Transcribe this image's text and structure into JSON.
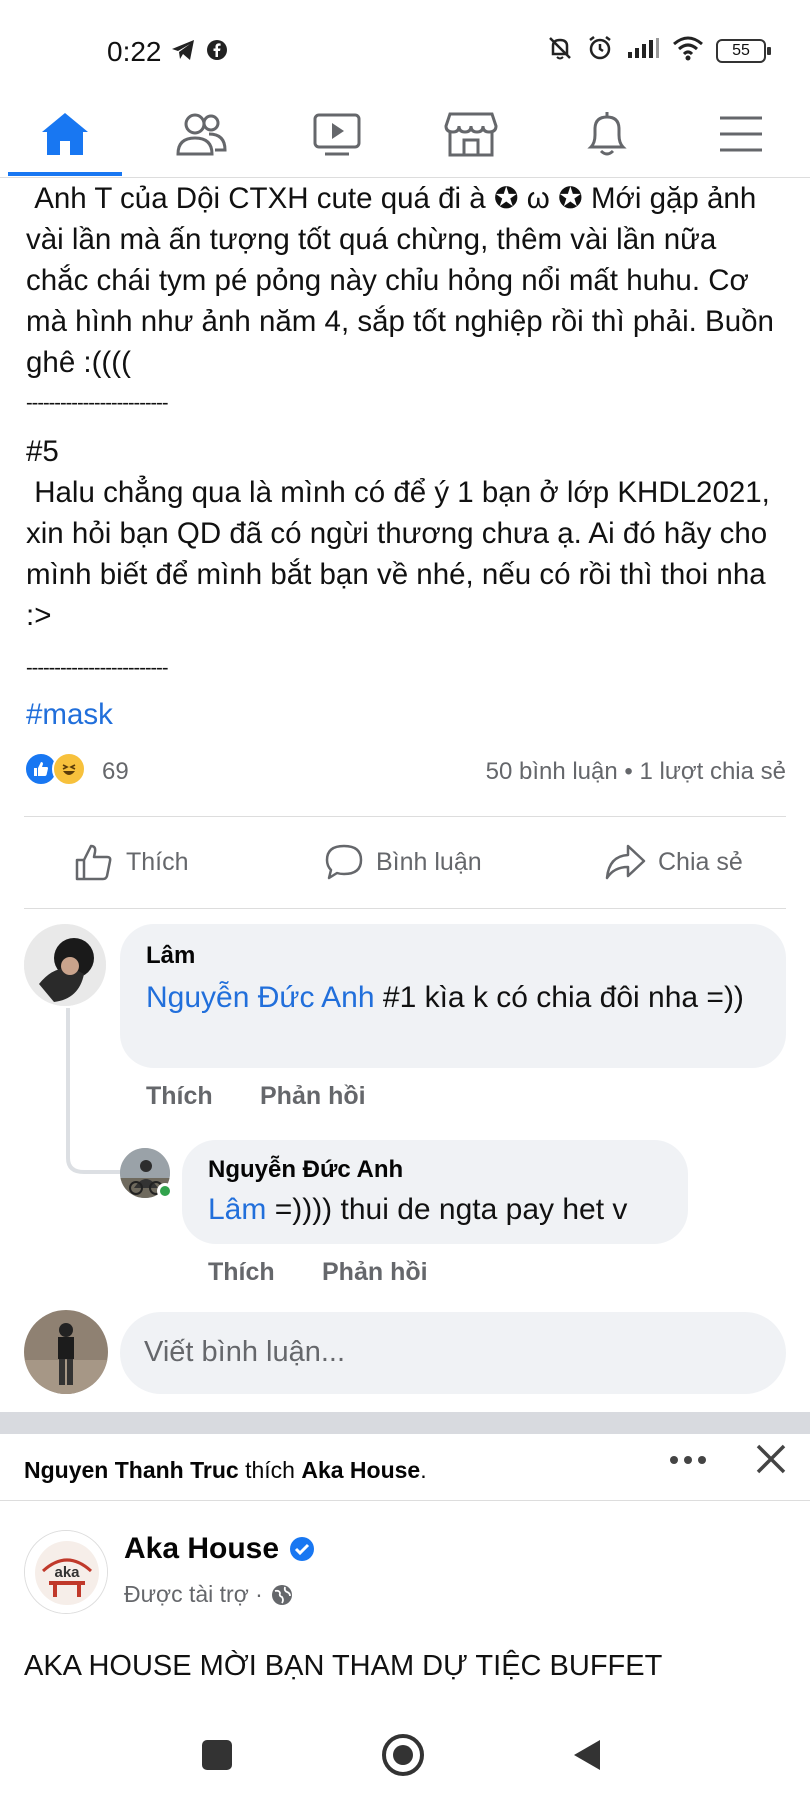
{
  "status_bar": {
    "time": "0:22",
    "battery": "55"
  },
  "nav": {
    "tabs": [
      "home",
      "friends",
      "watch",
      "marketplace",
      "notifications",
      "menu"
    ],
    "active": "home",
    "accent": "#1877f2"
  },
  "post": {
    "lines": [
      " Anh T của Dội CTXH cute quá đi à ✪ ω ✪ Mới gặp ảnh vài lần mà ấn tượng tốt quá chừng, thêm vài lần nữa chắc chái tym pé pỏng này chỉu hỏng nổi mất huhu. Cơ mà hình như ảnh năm 4, sắp tốt nghiệp rồi thì phải. Buồn ghê :(((("
    ],
    "separator1": "-------------------------",
    "section_number": "#5",
    "section_text": " Halu chẳng qua là mình có để ý 1 bạn ở lớp KHDL2021, xin hỏi bạn QD đã có ngừi thương chưa ạ. Ai đó hãy cho mình biết để mình bắt bạn về nhé, nếu có rồi thì thoi nha :>",
    "separator2": "-------------------------",
    "hashtag": "#mask",
    "reaction_count": "69",
    "stats": "50 bình luận • 1 lượt chia sẻ",
    "actions": {
      "like": "Thích",
      "comment": "Bình luận",
      "share": "Chia sẻ"
    }
  },
  "comments": [
    {
      "name": "Lâm",
      "mention": "Nguyễn Đức Anh",
      "text": "  #1 kìa k có chia đôi nha =))",
      "like": "Thích",
      "reply": "Phản hồi"
    },
    {
      "name": "Nguyễn Đức Anh",
      "mention": "Lâm",
      "text": " =)))) thui de ngta pay het v",
      "like": "Thích",
      "reply": "Phản hồi"
    }
  ],
  "write_comment": {
    "placeholder": "Viết bình luận..."
  },
  "next_post": {
    "liker": "Nguyen Thanh Truc",
    "liker_action": " thích ",
    "liked_page": "Aka House",
    "liked_suffix": ".",
    "page_name": "Aka House",
    "sponsored": "Được tài trợ ·",
    "text": "AKA HOUSE MỜI BẠN THAM DỰ TIỆC BUFFET"
  }
}
